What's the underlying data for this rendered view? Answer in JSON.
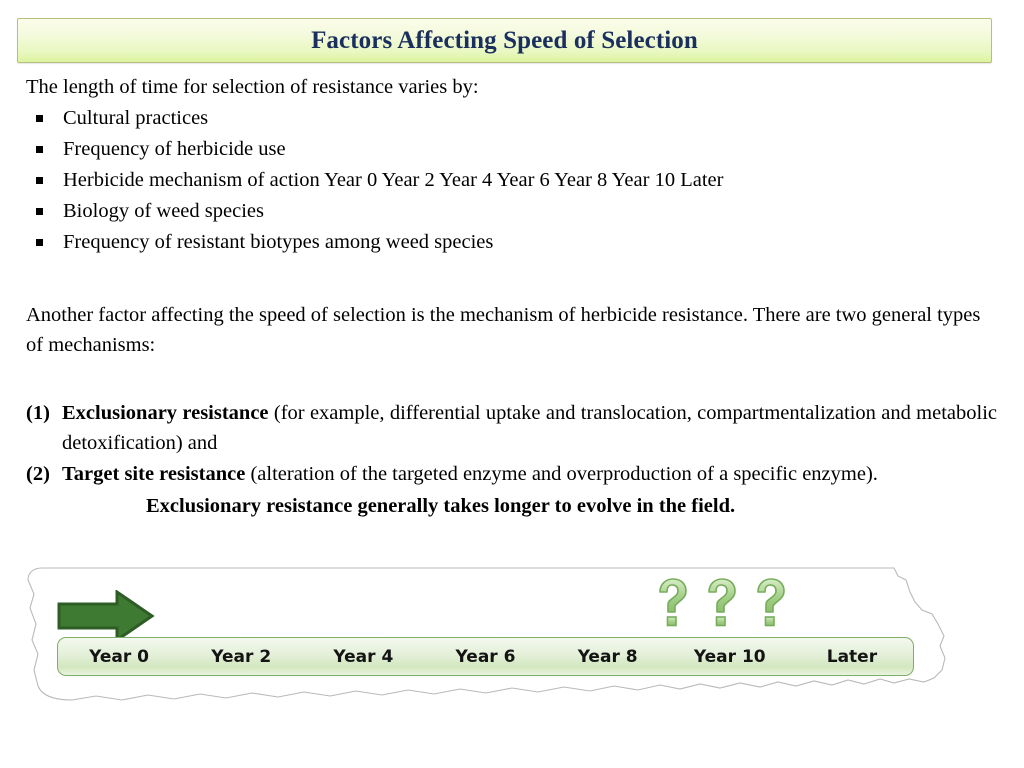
{
  "slide": {
    "title": "Factors Affecting Speed of Selection",
    "title_color": "#1b2f5e",
    "banner_border_color": "#b7bf7c"
  },
  "body": {
    "lead": "The length of time for selection of resistance varies by:",
    "bullets": [
      "Cultural practices",
      "Frequency of herbicide use",
      "Herbicide mechanism of action Year 0 Year 2 Year 4 Year 6 Year 8 Year 10 Later",
      "Biology of weed species",
      "Frequency of resistant biotypes among weed species"
    ],
    "paragraph": "Another factor affecting the speed of selection is the mechanism of herbicide resistance. There are two general types of mechanisms:",
    "items": [
      {
        "number": "(1)",
        "term": "Exclusionary resistance",
        "detail": " (for example, differential uptake and translocation, compartmentalization and metabolic detoxification) and"
      },
      {
        "number": "(2)",
        "term": "Target site resistance",
        "detail": " (alteration of the targeted enzyme and overproduction of a specific enzyme)."
      }
    ],
    "closing_bold": "Exclusionary resistance generally takes longer to evolve in the field."
  },
  "diagram": {
    "arrow_icon": "green-right-arrow-icon",
    "arrow_fill": "#3f7a33",
    "arrow_stroke": "#2d5c24",
    "question_marks": [
      "?",
      "?",
      "?"
    ],
    "question_mark_color": "#86b86a",
    "timeline_labels": [
      "Year 0",
      "Year 2",
      "Year 4",
      "Year 6",
      "Year 8",
      "Year 10",
      "Later"
    ],
    "bar_border_color": "#7fae6a"
  }
}
